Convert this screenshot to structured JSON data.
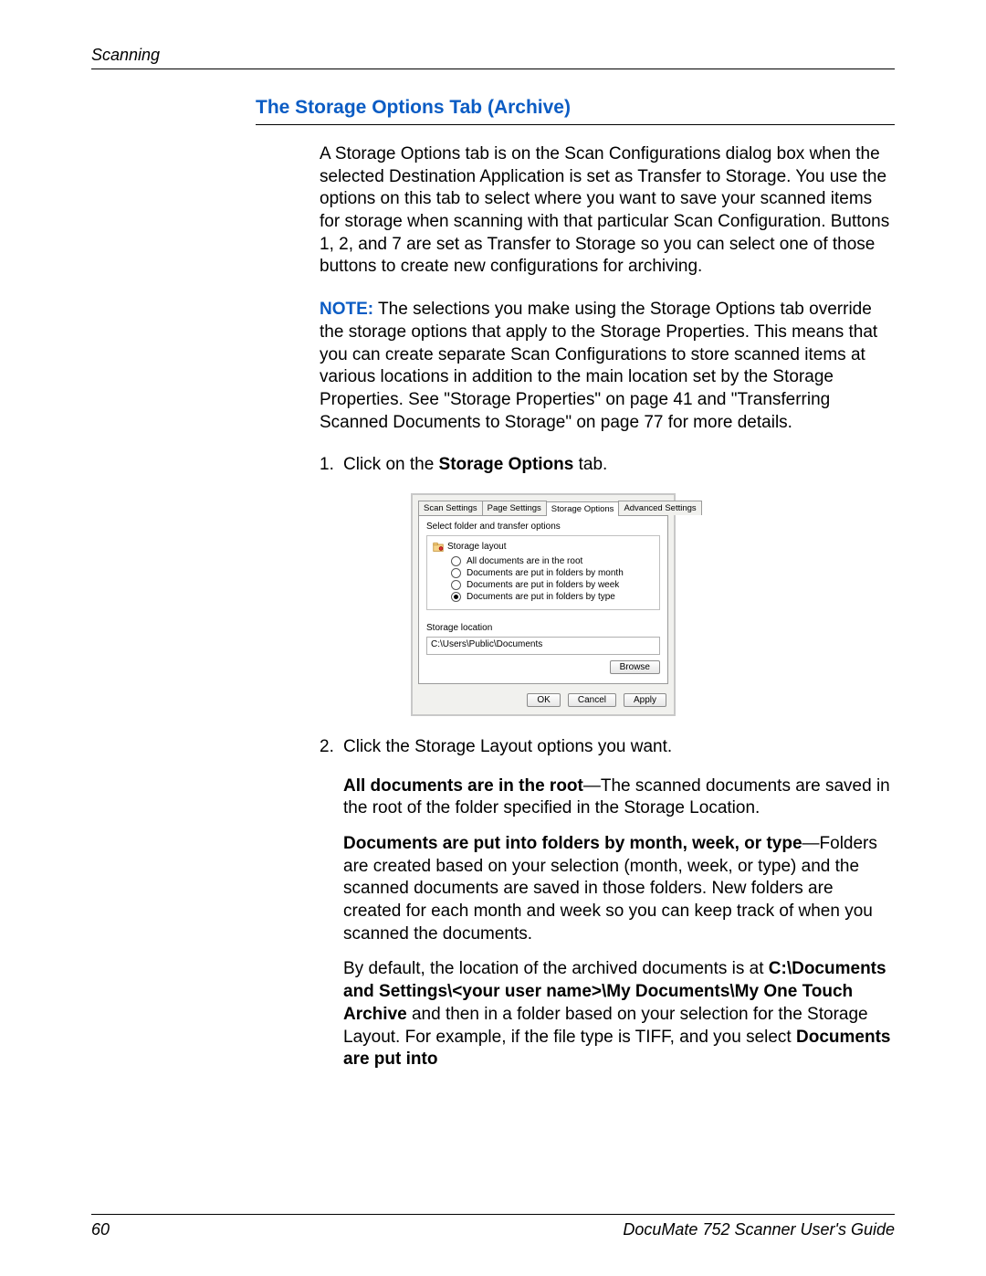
{
  "header": {
    "running": "Scanning"
  },
  "section": {
    "title": "The Storage Options Tab (Archive)"
  },
  "para1": "A Storage Options tab is on the Scan Configurations dialog box when the selected Destination Application is set as Transfer to Storage. You use the options on this tab to select where you want to save your scanned items for storage when scanning with that particular Scan Configuration. Buttons 1, 2, and 7 are set as Transfer to Storage so you can select one of those buttons to create new configurations for archiving.",
  "note": {
    "label": "NOTE:",
    "text": " The selections you make using the Storage Options tab override the storage options that apply to the Storage Properties. This means that you can create separate Scan Configurations to store scanned items at various locations in addition to the main location set by the Storage Properties. See \"Storage Properties\" on page 41 and \"Transferring Scanned Documents to Storage\" on page 77 for more details."
  },
  "steps": {
    "s1_pre": "Click on the ",
    "s1_bold": "Storage Options",
    "s1_post": " tab.",
    "s2": "Click the Storage Layout options you want.",
    "s2a_bold": "All documents are in the root",
    "s2a_rest": "—The scanned documents are saved in the root of the folder specified in the Storage Location.",
    "s2b_bold": "Documents are put into folders by month, week, or type",
    "s2b_rest": "—Folders are created based on your selection (month, week, or type) and the scanned documents are saved in those folders. New folders are created for each month and week so you can keep track of when you scanned the documents.",
    "s2c_pre": "By default, the location of the archived documents is at ",
    "s2c_bold1": "C:\\Documents and Settings\\<your user name>\\My Documents\\My One Touch Archive",
    "s2c_mid": " and then in a folder based on your selection for the Storage Layout. For example, if the file type is TIFF, and you select ",
    "s2c_bold2": "Documents are put into"
  },
  "dialog": {
    "tabs": [
      "Scan Settings",
      "Page Settings",
      "Storage Options",
      "Advanced Settings"
    ],
    "active_tab_index": 2,
    "fieldset_label": "Select folder and transfer options",
    "layout_label": "Storage layout",
    "radios": [
      {
        "label": "All documents are in the root",
        "selected": false
      },
      {
        "label": "Documents are put in folders by month",
        "selected": false
      },
      {
        "label": "Documents are put in folders by week",
        "selected": false
      },
      {
        "label": "Documents are put in folders by type",
        "selected": true
      }
    ],
    "location_label": "Storage location",
    "location_value": "C:\\Users\\Public\\Documents",
    "browse": "Browse",
    "ok": "OK",
    "cancel": "Cancel",
    "apply": "Apply"
  },
  "footer": {
    "page": "60",
    "guide": "DocuMate 752 Scanner User's Guide"
  }
}
